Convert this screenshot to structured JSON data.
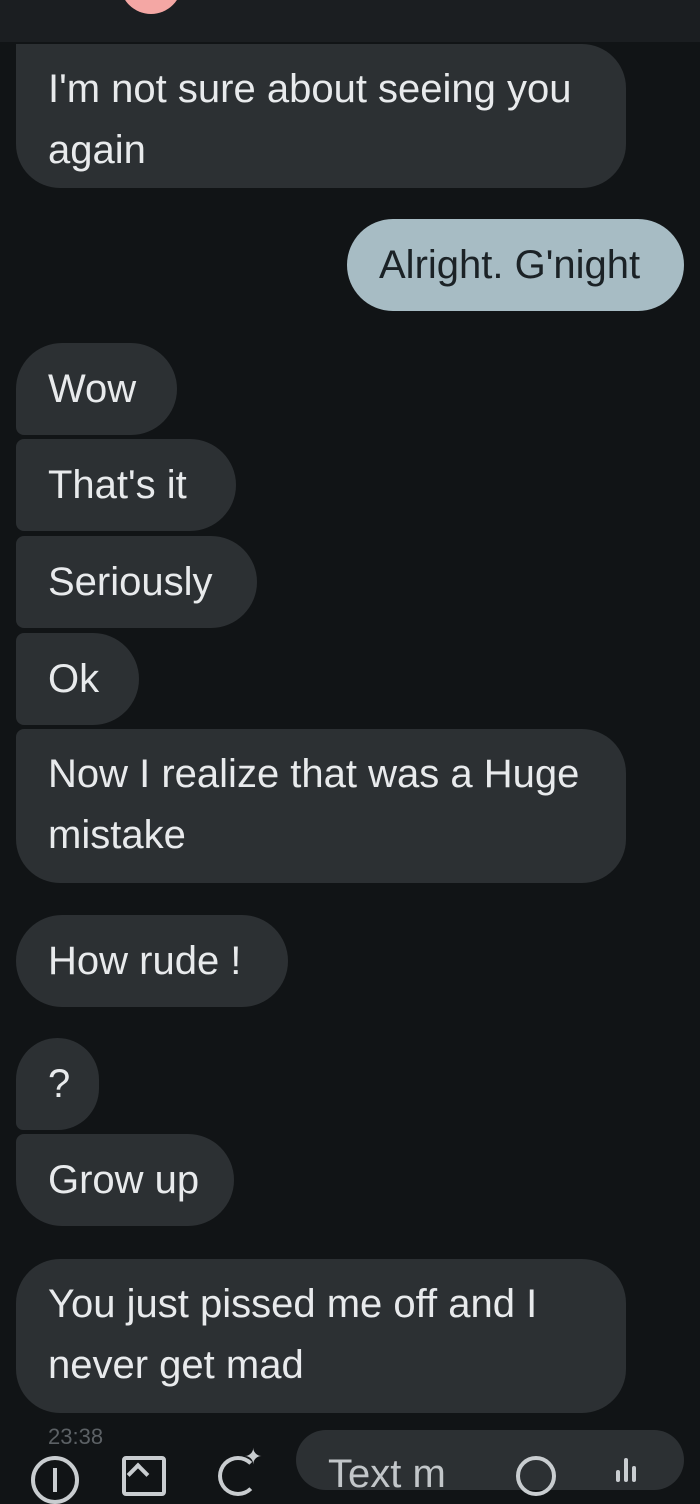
{
  "conversation": {
    "messages": [
      {
        "direction": "incoming",
        "text": "I'm not sure about seeing you again",
        "lines": [
          "I'm not sure about seeing you",
          "again"
        ]
      },
      {
        "direction": "outgoing",
        "text": "Alright. G'night"
      },
      {
        "direction": "incoming",
        "text": "Wow"
      },
      {
        "direction": "incoming",
        "text": "That's it"
      },
      {
        "direction": "incoming",
        "text": "Seriously"
      },
      {
        "direction": "incoming",
        "text": "Ok"
      },
      {
        "direction": "incoming",
        "text": "Now I realize that was a Huge mistake",
        "lines": [
          "Now I realize that was a Huge",
          "mistake"
        ]
      },
      {
        "direction": "incoming",
        "text": "How rude !"
      },
      {
        "direction": "incoming",
        "text": "?"
      },
      {
        "direction": "incoming",
        "text": "Grow up"
      },
      {
        "direction": "incoming",
        "text": "You just pissed me off and I never get mad",
        "lines": [
          "You just pissed me off and I",
          "never get mad"
        ]
      }
    ],
    "last_timestamp": "23:38"
  },
  "composer": {
    "placeholder_visible": "Text m",
    "icons": [
      "plus-icon",
      "gallery-icon",
      "ai-sparkle-icon",
      "emoji-icon",
      "voice-icon"
    ]
  },
  "colors": {
    "background": "#111416",
    "incoming_bubble": "#2c3033",
    "outgoing_bubble": "#a7bcc4",
    "header_avatar": "#f4a7a4"
  }
}
